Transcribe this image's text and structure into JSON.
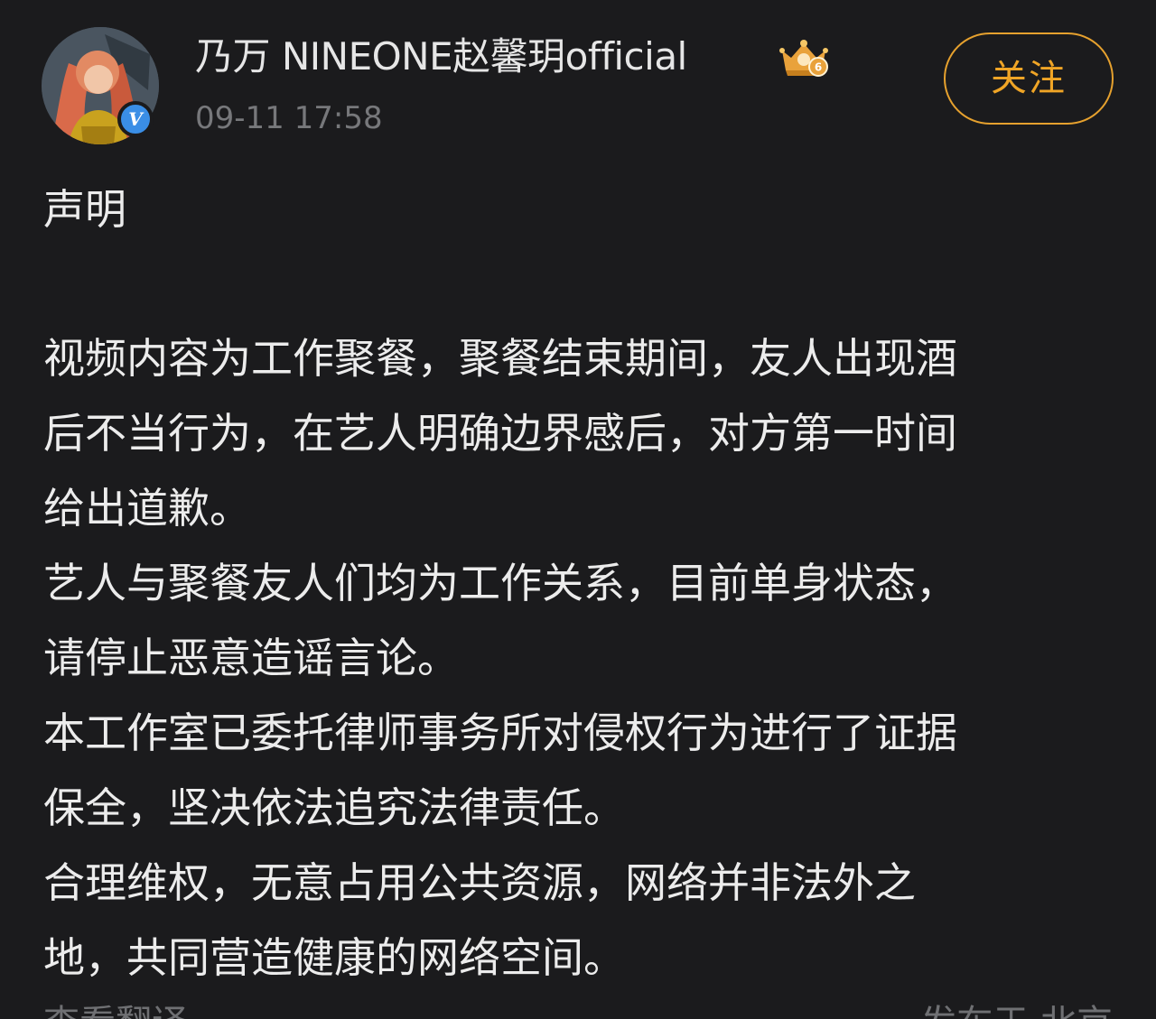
{
  "header": {
    "username": "乃万 NINEONE赵馨玥official",
    "timestamp": "09-11 17:58",
    "verified_mark": "V",
    "vip_level": "6",
    "follow_label": "关注"
  },
  "post": {
    "title": "声明",
    "lines": [
      "视频内容为工作聚餐，聚餐结束期间，友人出现酒",
      "后不当行为，在艺人明确边界感后，对方第一时间",
      "给出道歉。",
      "艺人与聚餐友人们均为工作关系，目前单身状态，",
      "请停止恶意造谣言论。",
      "本工作室已委托律师事务所对侵权行为进行了证据",
      "保全，坚决依法追究法律责任。",
      "合理维权，无意占用公共资源，网络并非法外之",
      "地，共同营造健康的网络空间。"
    ]
  },
  "footer": {
    "translate_label": "查看翻译",
    "location": "发布于 北京"
  },
  "colors": {
    "background": "#1b1b1d",
    "text": "#ececec",
    "muted": "#77787b",
    "accent": "#f0a526",
    "verified": "#3a8ee6"
  }
}
